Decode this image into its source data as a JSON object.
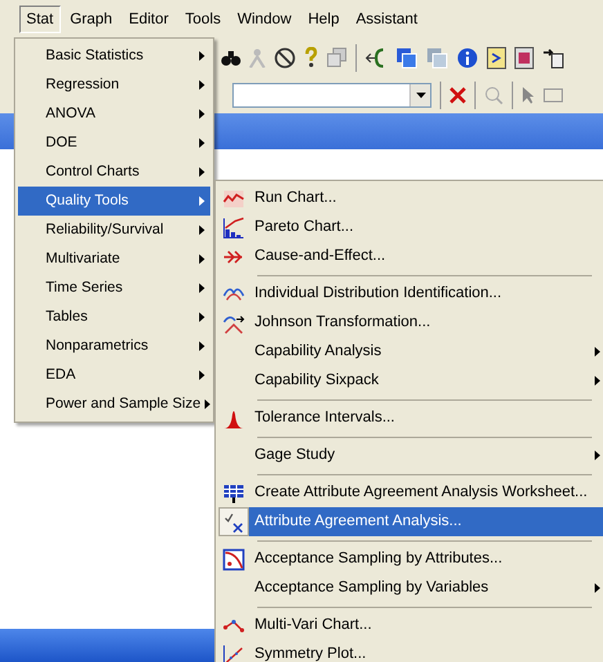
{
  "menu_bar": [
    {
      "label": "Stat",
      "selected": true
    },
    {
      "label": "Graph",
      "selected": false
    },
    {
      "label": "Editor",
      "selected": false
    },
    {
      "label": "Tools",
      "selected": false
    },
    {
      "label": "Window",
      "selected": false
    },
    {
      "label": "Help",
      "selected": false
    },
    {
      "label": "Assistant",
      "selected": false
    }
  ],
  "stat_menu": {
    "items": [
      {
        "label": "Basic Statistics",
        "selected": false,
        "has_submenu": true
      },
      {
        "label": "Regression",
        "selected": false,
        "has_submenu": true
      },
      {
        "label": "ANOVA",
        "selected": false,
        "has_submenu": true
      },
      {
        "label": "DOE",
        "selected": false,
        "has_submenu": true
      },
      {
        "label": "Control Charts",
        "selected": false,
        "has_submenu": true
      },
      {
        "label": "Quality Tools",
        "selected": true,
        "has_submenu": true
      },
      {
        "label": "Reliability/Survival",
        "selected": false,
        "has_submenu": true
      },
      {
        "label": "Multivariate",
        "selected": false,
        "has_submenu": true
      },
      {
        "label": "Time Series",
        "selected": false,
        "has_submenu": true
      },
      {
        "label": "Tables",
        "selected": false,
        "has_submenu": true
      },
      {
        "label": "Nonparametrics",
        "selected": false,
        "has_submenu": true
      },
      {
        "label": "EDA",
        "selected": false,
        "has_submenu": true
      },
      {
        "label": "Power and Sample Size",
        "selected": false,
        "has_submenu": true
      }
    ]
  },
  "quality_tools_menu": {
    "items": [
      {
        "kind": "item",
        "label": "Run Chart...",
        "selected": false,
        "has_submenu": false
      },
      {
        "kind": "item",
        "label": "Pareto Chart...",
        "selected": false,
        "has_submenu": false
      },
      {
        "kind": "item",
        "label": "Cause-and-Effect...",
        "selected": false,
        "has_submenu": false
      },
      {
        "kind": "separator"
      },
      {
        "kind": "item",
        "label": "Individual Distribution Identification...",
        "selected": false,
        "has_submenu": false
      },
      {
        "kind": "item",
        "label": "Johnson Transformation...",
        "selected": false,
        "has_submenu": false
      },
      {
        "kind": "item",
        "label": "Capability Analysis",
        "selected": false,
        "has_submenu": true
      },
      {
        "kind": "item",
        "label": "Capability Sixpack",
        "selected": false,
        "has_submenu": true
      },
      {
        "kind": "separator"
      },
      {
        "kind": "item",
        "label": "Tolerance Intervals...",
        "selected": false,
        "has_submenu": false
      },
      {
        "kind": "separator"
      },
      {
        "kind": "item",
        "label": "Gage Study",
        "selected": false,
        "has_submenu": true
      },
      {
        "kind": "separator"
      },
      {
        "kind": "item",
        "label": "Create Attribute Agreement Analysis Worksheet...",
        "selected": false,
        "has_submenu": false
      },
      {
        "kind": "item",
        "label": "Attribute Agreement Analysis...",
        "selected": true,
        "has_submenu": false
      },
      {
        "kind": "separator"
      },
      {
        "kind": "item",
        "label": "Acceptance Sampling by Attributes...",
        "selected": false,
        "has_submenu": false
      },
      {
        "kind": "item",
        "label": "Acceptance Sampling by Variables",
        "selected": false,
        "has_submenu": true
      },
      {
        "kind": "separator"
      },
      {
        "kind": "item",
        "label": "Multi-Vari Chart...",
        "selected": false,
        "has_submenu": false
      },
      {
        "kind": "item",
        "label": "Symmetry Plot...",
        "selected": false,
        "has_submenu": false
      }
    ]
  }
}
